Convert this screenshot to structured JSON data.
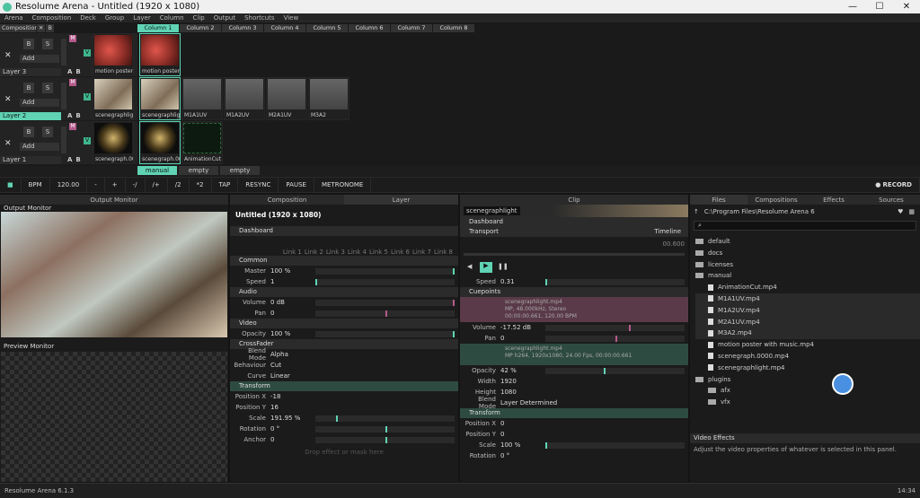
{
  "title": "Resolume Arena - Untitled (1920 x 1080)",
  "menu": [
    "Arena",
    "Composition",
    "Deck",
    "Group",
    "Layer",
    "Column",
    "Clip",
    "Output",
    "Shortcuts",
    "View"
  ],
  "composition_label": "Composition",
  "columns": [
    "Column 1",
    "Column 2",
    "Column 3",
    "Column 4",
    "Column 5",
    "Column 6",
    "Column 7",
    "Column 8"
  ],
  "layers": [
    {
      "name": "Layer 3",
      "add": "Add",
      "clips": [
        "motion poster wit…",
        "motion poster wit…"
      ]
    },
    {
      "name": "Layer 2",
      "add": "Add",
      "clips": [
        "scenegraphlight",
        "scenegraphlight",
        "M1A1UV",
        "M1A2UV",
        "M2A1UV",
        "M3A2"
      ]
    },
    {
      "name": "Layer 1",
      "add": "Add",
      "clips": [
        "scenegraph.0000",
        "scenegraph.0000",
        "AnimationCut"
      ]
    }
  ],
  "deck_tabs": [
    "manual",
    "empty",
    "empty"
  ],
  "bpm": {
    "label": "BPM",
    "value": "120.00",
    "buttons": [
      "-",
      "+",
      "-/",
      "/+",
      "/2",
      "*2",
      "TAP",
      "RESYNC",
      "PAUSE",
      "METRONOME"
    ],
    "record": "RECORD"
  },
  "output": {
    "header": "Output Monitor",
    "title": "Output Monitor",
    "preview": "Preview Monitor"
  },
  "layer_panel": {
    "tabs": [
      "Composition",
      "Layer"
    ],
    "title": "Untitled (1920 x 1080)",
    "dashboard": "Dashboard",
    "links": [
      "Link 1",
      "Link 2",
      "Link 3",
      "Link 4",
      "Link 5",
      "Link 6",
      "Link 7",
      "Link 8"
    ],
    "common": "Common",
    "master_label": "Master",
    "master_value": "100 %",
    "speed_label": "Speed",
    "speed_value": "1",
    "audio": "Audio",
    "volume_label": "Volume",
    "volume_value": "0 dB",
    "pan_label": "Pan",
    "pan_value": "0",
    "video": "Video",
    "opacity_label": "Opacity",
    "opacity_value": "100 %",
    "crossfader": "CrossFader",
    "blend_label": "Blend Mode",
    "blend_value": "Alpha",
    "behaviour_label": "Behaviour",
    "behaviour_value": "Cut",
    "curve_label": "Curve",
    "curve_value": "Linear",
    "transform": "Transform",
    "posx_label": "Position X",
    "posx_value": "-18",
    "posy_label": "Position Y",
    "posy_value": "16",
    "scale_label": "Scale",
    "scale_value": "191.95 %",
    "rotation_label": "Rotation",
    "rotation_value": "0 °",
    "anchor_label": "Anchor",
    "anchor_value": "0",
    "drop_hint": "Drop effect or mask here"
  },
  "clip_panel": {
    "tab": "Clip",
    "name": "scenegraphlight",
    "dashboard": "Dashboard",
    "transport": "Transport",
    "timeline": "Timeline",
    "time": "00.600",
    "speed_label": "Speed",
    "speed_value": "0.31",
    "cuepoints": "Cuepoints",
    "audio_file": "scenegraphlight.mp4",
    "audio_meta": "MP, 48.000kHz, Stereo",
    "audio_time": "00:00:00.661, 120.00 BPM",
    "volume_label": "Volume",
    "volume_value": "-17.52 dB",
    "pan_label": "Pan",
    "pan_value": "0",
    "video_file": "scenegraphlight.mp4",
    "video_meta": "MP h264, 1920x1080, 24.00 Fps, 00:00:00.661",
    "opacity_label": "Opacity",
    "opacity_value": "42 %",
    "width_label": "Width",
    "width_value": "1920",
    "height_label": "Height",
    "height_value": "1080",
    "blend_label": "Blend Mode",
    "blend_value": "Layer Determined",
    "transform": "Transform",
    "posx_label": "Position X",
    "posx_value": "0",
    "posy_label": "Position Y",
    "posy_value": "0",
    "scale_label": "Scale",
    "scale_value": "100 %",
    "rotation_label": "Rotation",
    "rotation_value": "0 °"
  },
  "files": {
    "tabs": [
      "Files",
      "Compositions",
      "Effects",
      "Sources"
    ],
    "path": "C:\\Program Files\\Resolume Arena 6",
    "tree": [
      {
        "t": "folder",
        "name": "default",
        "lvl": 0
      },
      {
        "t": "folder",
        "name": "docs",
        "lvl": 0
      },
      {
        "t": "folder",
        "name": "licenses",
        "lvl": 0
      },
      {
        "t": "folder",
        "name": "manual",
        "lvl": 0
      },
      {
        "t": "file",
        "name": "AnimationCut.mp4",
        "lvl": 1
      },
      {
        "t": "file",
        "name": "M1A1UV.mp4",
        "lvl": 1
      },
      {
        "t": "file",
        "name": "M1A2UV.mp4",
        "lvl": 1
      },
      {
        "t": "file",
        "name": "M2A1UV.mp4",
        "lvl": 1
      },
      {
        "t": "file",
        "name": "M3A2.mp4",
        "lvl": 1
      },
      {
        "t": "file",
        "name": "motion poster with music.mp4",
        "lvl": 1
      },
      {
        "t": "file",
        "name": "scenegraph.0000.mp4",
        "lvl": 1
      },
      {
        "t": "file",
        "name": "scenegraphlight.mp4",
        "lvl": 1
      },
      {
        "t": "folder",
        "name": "plugins",
        "lvl": 0
      },
      {
        "t": "folder",
        "name": "afx",
        "lvl": 1
      },
      {
        "t": "folder",
        "name": "vfx",
        "lvl": 1
      }
    ],
    "help_title": "Video Effects",
    "help_text": "Adjust the video properties of whatever is selected in this panel."
  },
  "status": {
    "left": "Resolume Arena 6.1.3",
    "right": "14:34"
  }
}
